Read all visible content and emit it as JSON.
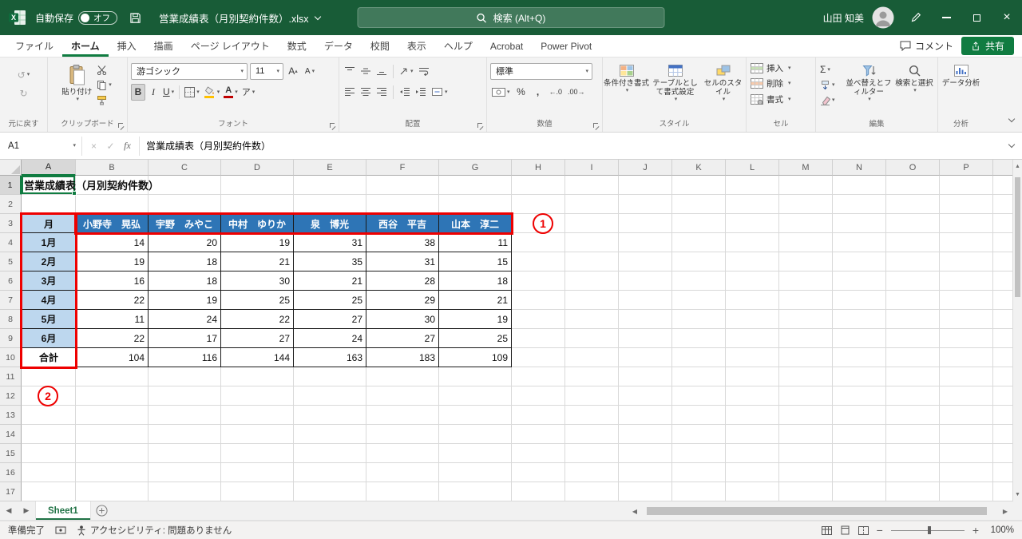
{
  "titlebar": {
    "autosave": "自動保存",
    "autosave_state": "オフ",
    "filename": "営業成績表（月別契約件数）.xlsx",
    "search": "検索 (Alt+Q)",
    "user": "山田 知美"
  },
  "ribbon": {
    "tabs": [
      "ファイル",
      "ホーム",
      "挿入",
      "描画",
      "ページ レイアウト",
      "数式",
      "データ",
      "校閲",
      "表示",
      "ヘルプ",
      "Acrobat",
      "Power Pivot"
    ],
    "active_tab": "ホーム",
    "comments": "コメント",
    "share": "共有",
    "paste": "貼り付け",
    "font_name": "游ゴシック",
    "font_size": "11",
    "number_format": "標準",
    "conditional_formatting": "条件付き書式",
    "format_as_table": "テーブルとして書式設定",
    "cell_styles": "セルのスタイル",
    "insert": "挿入",
    "delete": "削除",
    "format": "書式",
    "sort_filter": "並べ替えとフィルター",
    "find_select": "検索と選択",
    "data_analysis": "データ分析",
    "group_labels": {
      "undo": "元に戻す",
      "clipboard": "クリップボード",
      "font": "フォント",
      "alignment": "配置",
      "number": "数値",
      "styles": "スタイル",
      "cells": "セル",
      "editing": "編集",
      "analysis": "分析"
    }
  },
  "formula_bar": {
    "name_box": "A1",
    "fx": "fx",
    "formula": "営業成績表（月別契約件数）"
  },
  "sheet": {
    "col_letters": [
      "A",
      "B",
      "C",
      "D",
      "E",
      "F",
      "G",
      "H",
      "I",
      "J",
      "K",
      "L",
      "M",
      "N",
      "O",
      "P"
    ],
    "row_count": 17,
    "title": "営業成績表（月別契約件数）",
    "month_header": "月",
    "names": [
      "小野寺　晃弘",
      "宇野　みやこ",
      "中村　ゆりか",
      "泉　博光",
      "西谷　平吉",
      "山本　淳二"
    ],
    "months": [
      "1月",
      "2月",
      "3月",
      "4月",
      "5月",
      "6月"
    ],
    "values": [
      [
        14,
        20,
        19,
        31,
        38,
        11
      ],
      [
        19,
        18,
        21,
        35,
        31,
        15
      ],
      [
        16,
        18,
        30,
        21,
        28,
        18
      ],
      [
        22,
        19,
        25,
        25,
        29,
        21
      ],
      [
        11,
        24,
        22,
        27,
        30,
        19
      ],
      [
        22,
        17,
        27,
        24,
        27,
        25
      ]
    ],
    "total_label": "合計",
    "totals": [
      104,
      116,
      144,
      163,
      183,
      109
    ]
  },
  "annotations": {
    "markers": [
      "1",
      "2"
    ]
  },
  "sheet_tabs": {
    "active": "Sheet1"
  },
  "statusbar": {
    "ready": "準備完了",
    "accessibility": "アクセシビリティ: 問題ありません",
    "zoom": "100%"
  },
  "icons": {
    "undo": "↺",
    "redo": "↻",
    "bold": "B",
    "italic": "I",
    "underline": "U",
    "font_color": "A",
    "grow_font": "A",
    "shrink_font": "A",
    "phonetic": "ア",
    "percent": "%",
    "comma": ",",
    "increase_decimal": "←.0",
    "decrease_decimal": ".00→",
    "autosum": "Σ",
    "cancel": "×",
    "check": "✓",
    "close": "×",
    "zoom_out": "−",
    "zoom_in": "+"
  },
  "colors": {
    "titlebar_green": "#185C37",
    "accent_green": "#107C41",
    "table_header_blue": "#2E75B6",
    "month_cell_blue": "#BDD7EE",
    "annotation_red": "#EE0000"
  }
}
